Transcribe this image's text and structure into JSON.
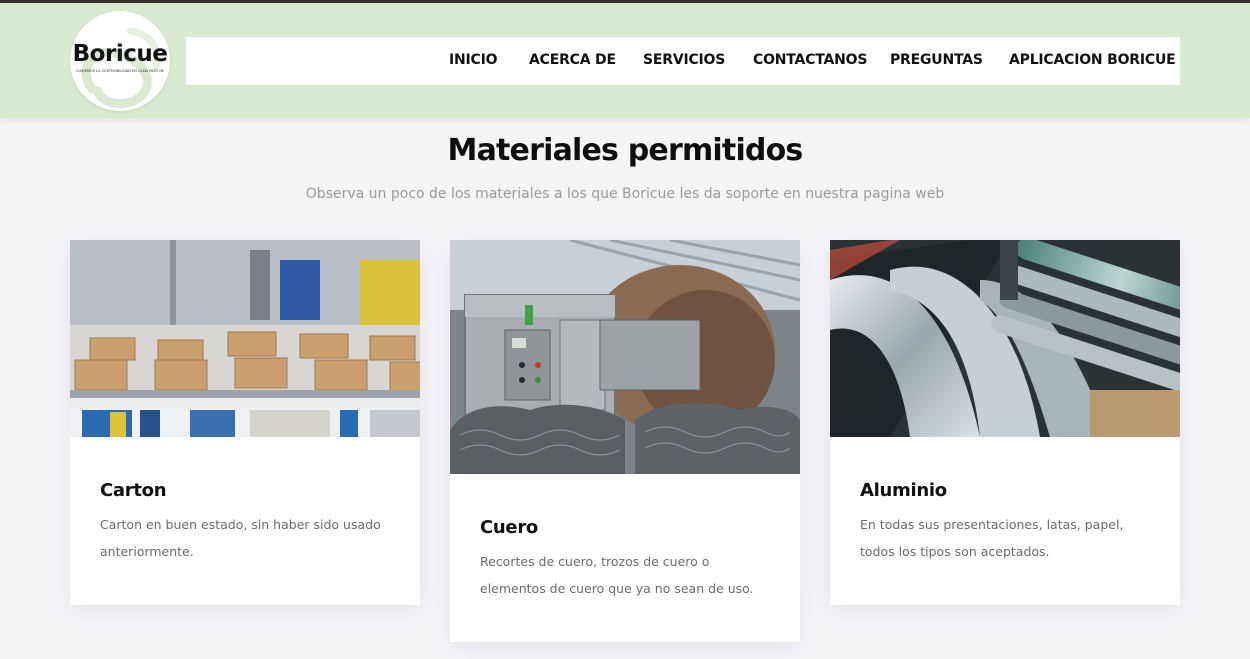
{
  "brand": {
    "name": "Boricue",
    "tagline": "CUIDEMOS LA SOSTENIBILIDAD EN CADA PASO RECICLANDO",
    "logo_icon": "recycle-loop-icon"
  },
  "nav": {
    "items": [
      "INICIO",
      "ACERCA DE",
      "SERVICIOS",
      "CONTACTANOS",
      "PREGUNTAS",
      "APLICACION BORICUE"
    ]
  },
  "section": {
    "title": "Materiales permitidos",
    "subtitle": "Observa un poco de los materiales a los que Boricue les da soporte en nuestra pagina web"
  },
  "cards": [
    {
      "title": "Carton",
      "description": "Carton en buen estado, sin haber sido usado anteriormente.",
      "image": "cardboard-boxes-conveyor-photo"
    },
    {
      "title": "Cuero",
      "description": "Recortes de cuero, trozos de cuero o elementos de cuero que ya no sean de uso.",
      "image": "leather-processing-machine-photo"
    },
    {
      "title": "Aluminio",
      "description": "En todas sus presentaciones, latas, papel, todos los tipos son aceptados.",
      "image": "aluminium-sheet-rollers-photo"
    }
  ],
  "colors": {
    "header_bg": "#d9ead1",
    "page_bg": "#f5f4f7",
    "nav_bg": "#ffffff",
    "text_dark": "#111111",
    "text_muted": "#9a9a9a"
  }
}
